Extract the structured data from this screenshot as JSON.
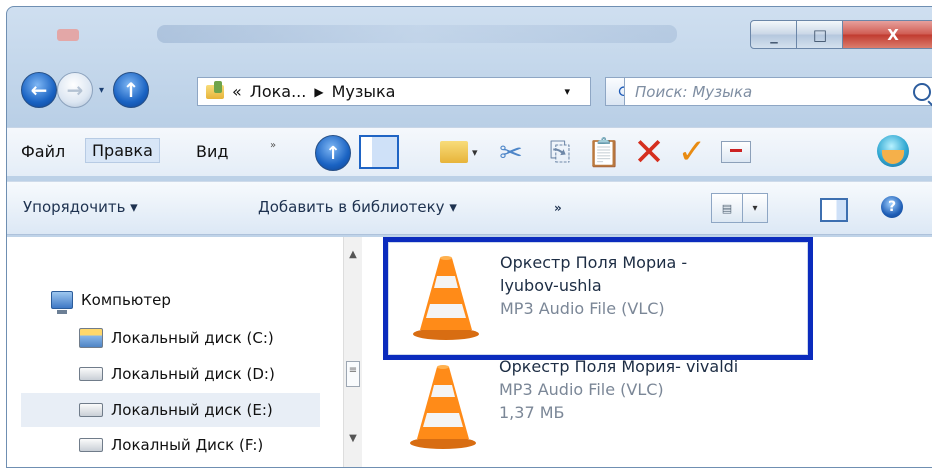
{
  "window": {
    "caption_buttons": {
      "minimize": "_",
      "maximize": "□",
      "close": "X"
    }
  },
  "address": {
    "back_icon": "←",
    "forward_icon": "→",
    "up_icon": "↑",
    "recent_icon": "▾",
    "folder_icon": "folder-icon",
    "crumb_prefix": "«",
    "crumb_1": "Лока...",
    "crumb_separator": "▶",
    "crumb_2": "Музыка",
    "dropdown": "▾",
    "refresh_icon": "⟳",
    "search_placeholder": "Поиск: Музыка"
  },
  "menubar": {
    "file": "Файл",
    "edit": "Правка",
    "view": "Вид",
    "chevron": "»",
    "up_icon": "↑",
    "cut_icon": "✂",
    "copy_icon": "⎘",
    "paste_icon": "📋",
    "delete_icon": "✕",
    "check_icon": "✓"
  },
  "commandbar": {
    "organize": "Упорядочить ▾",
    "add_to_library": "Добавить в библиотеку ▾",
    "more": "»",
    "view_icon": "▤",
    "view_dropdown": "▾",
    "help": "?"
  },
  "navpane": {
    "items": [
      {
        "label": "Компьютер",
        "icon": "computer-icon"
      },
      {
        "label": "Локальный диск (C:)",
        "icon": "system-drive-icon"
      },
      {
        "label": "Локальный диск (D:)",
        "icon": "drive-icon"
      },
      {
        "label": "Локальный диск (E:)",
        "icon": "drive-icon"
      },
      {
        "label": "Локалный Диск (F:)",
        "icon": "drive-icon"
      }
    ],
    "scroll_up": "▲",
    "scroll_thumb": "≡",
    "scroll_down": "▼"
  },
  "files": [
    {
      "name_line1": "Оркестр Поля Мориа -",
      "name_line2": "lyubov-ushla",
      "type": "MP3 Audio File (VLC)",
      "icon": "vlc-cone-icon"
    },
    {
      "name": "Оркестр Поля Мория- vivaldi",
      "type": "MP3 Audio File (VLC)",
      "size": "1,37 МБ",
      "icon": "vlc-cone-icon"
    }
  ]
}
